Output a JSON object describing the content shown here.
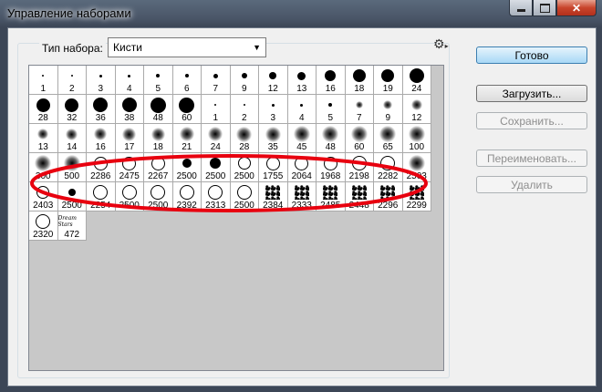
{
  "window": {
    "title": "Управление наборами"
  },
  "preset_type": {
    "label": "Тип набора:",
    "value": "Кисти"
  },
  "buttons": {
    "done": "Готово",
    "load": "Загрузить...",
    "save": "Сохранить...",
    "rename": "Переименовать...",
    "delete": "Удалить"
  },
  "brushes": [
    {
      "n": "1",
      "t": "dot",
      "s": 2
    },
    {
      "n": "2",
      "t": "dot",
      "s": 2
    },
    {
      "n": "3",
      "t": "dot",
      "s": 3
    },
    {
      "n": "4",
      "t": "dot",
      "s": 3
    },
    {
      "n": "5",
      "t": "dot",
      "s": 4
    },
    {
      "n": "6",
      "t": "dot",
      "s": 4
    },
    {
      "n": "7",
      "t": "dot",
      "s": 5
    },
    {
      "n": "9",
      "t": "dot",
      "s": 6
    },
    {
      "n": "12",
      "t": "dot",
      "s": 8
    },
    {
      "n": "13",
      "t": "dot",
      "s": 9
    },
    {
      "n": "16",
      "t": "dot",
      "s": 12
    },
    {
      "n": "18",
      "t": "dot",
      "s": 14
    },
    {
      "n": "19",
      "t": "dot",
      "s": 14
    },
    {
      "n": "24",
      "t": "dot",
      "s": 16
    },
    {
      "n": "28",
      "t": "dot",
      "s": 15
    },
    {
      "n": "32",
      "t": "dot",
      "s": 15
    },
    {
      "n": "36",
      "t": "dot",
      "s": 16
    },
    {
      "n": "38",
      "t": "dot",
      "s": 16
    },
    {
      "n": "48",
      "t": "dot",
      "s": 17
    },
    {
      "n": "60",
      "t": "dot",
      "s": 17
    },
    {
      "n": "1",
      "t": "dot",
      "s": 2
    },
    {
      "n": "2",
      "t": "dot",
      "s": 2
    },
    {
      "n": "3",
      "t": "dot",
      "s": 3
    },
    {
      "n": "4",
      "t": "dot",
      "s": 3
    },
    {
      "n": "5",
      "t": "dot",
      "s": 4
    },
    {
      "n": "7",
      "t": "soft",
      "s": 8
    },
    {
      "n": "9",
      "t": "soft",
      "s": 10
    },
    {
      "n": "12",
      "t": "soft",
      "s": 12
    },
    {
      "n": "13",
      "t": "soft",
      "s": 12
    },
    {
      "n": "14",
      "t": "soft",
      "s": 13
    },
    {
      "n": "16",
      "t": "soft",
      "s": 14
    },
    {
      "n": "17",
      "t": "soft",
      "s": 15
    },
    {
      "n": "18",
      "t": "soft",
      "s": 15
    },
    {
      "n": "21",
      "t": "soft",
      "s": 16
    },
    {
      "n": "24",
      "t": "soft",
      "s": 16
    },
    {
      "n": "28",
      "t": "soft",
      "s": 17
    },
    {
      "n": "35",
      "t": "soft",
      "s": 17
    },
    {
      "n": "45",
      "t": "soft",
      "s": 18
    },
    {
      "n": "48",
      "t": "soft",
      "s": 18
    },
    {
      "n": "60",
      "t": "soft",
      "s": 18
    },
    {
      "n": "65",
      "t": "soft",
      "s": 18
    },
    {
      "n": "100",
      "t": "soft",
      "s": 18
    },
    {
      "n": "300",
      "t": "soft",
      "s": 18
    },
    {
      "n": "500",
      "t": "soft",
      "s": 18
    },
    {
      "n": "2286",
      "t": "ring",
      "s": 15
    },
    {
      "n": "2475",
      "t": "ring",
      "s": 15
    },
    {
      "n": "2267",
      "t": "ring",
      "s": 15
    },
    {
      "n": "2500",
      "t": "dot",
      "s": 10
    },
    {
      "n": "2500",
      "t": "dot",
      "s": 12
    },
    {
      "n": "2500",
      "t": "ring",
      "s": 14
    },
    {
      "n": "1755",
      "t": "ring",
      "s": 15
    },
    {
      "n": "2064",
      "t": "ring",
      "s": 15
    },
    {
      "n": "1968",
      "t": "ring",
      "s": 15
    },
    {
      "n": "2198",
      "t": "ring",
      "s": 16
    },
    {
      "n": "2282",
      "t": "ring",
      "s": 16
    },
    {
      "n": "2503",
      "t": "soft",
      "s": 18
    },
    {
      "n": "2403",
      "t": "ring",
      "s": 14
    },
    {
      "n": "2500",
      "t": "dot",
      "s": 8
    },
    {
      "n": "2254",
      "t": "ring",
      "s": 16
    },
    {
      "n": "2500",
      "t": "ring",
      "s": 16
    },
    {
      "n": "2500",
      "t": "ring",
      "s": 16
    },
    {
      "n": "2392",
      "t": "ring",
      "s": 16
    },
    {
      "n": "2313",
      "t": "ring",
      "s": 16
    },
    {
      "n": "2500",
      "t": "ring",
      "s": 16
    },
    {
      "n": "2384",
      "t": "scatter",
      "s": 16
    },
    {
      "n": "2333",
      "t": "scatter",
      "s": 16
    },
    {
      "n": "2485",
      "t": "scatter",
      "s": 16
    },
    {
      "n": "2448",
      "t": "scatter",
      "s": 16
    },
    {
      "n": "2296",
      "t": "scatter",
      "s": 16
    },
    {
      "n": "2299",
      "t": "scatter",
      "s": 16
    },
    {
      "n": "2320",
      "t": "ring",
      "s": 16
    },
    {
      "n": "472",
      "t": "text",
      "s": 16,
      "label": "Dream Stars"
    }
  ],
  "colors": {
    "annotation": "#e8000f",
    "done_button": "#a8d8f6"
  }
}
